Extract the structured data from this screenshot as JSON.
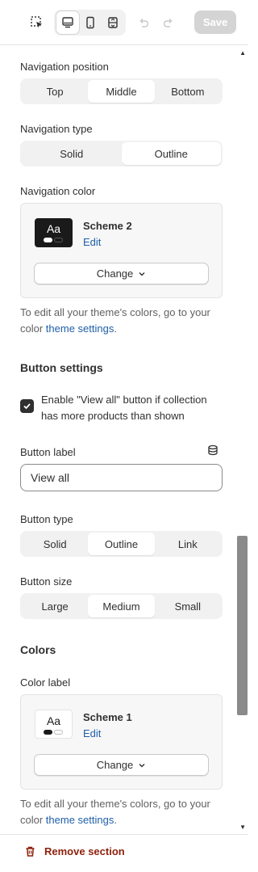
{
  "toolbar": {
    "tools": [
      "inspector-icon",
      "desktop-icon",
      "mobile-icon",
      "fullwidth-icon",
      "undo-icon",
      "redo-icon"
    ],
    "save_label": "Save"
  },
  "navigation_position": {
    "label": "Navigation position",
    "options": [
      "Top",
      "Middle",
      "Bottom"
    ],
    "selected": "Middle"
  },
  "navigation_type": {
    "label": "Navigation type",
    "options": [
      "Solid",
      "Outline"
    ],
    "selected": "Outline"
  },
  "navigation_color": {
    "label": "Navigation color",
    "swatch_text": "Aa",
    "scheme_name": "Scheme 2",
    "edit_label": "Edit",
    "change_label": "Change"
  },
  "help_text_1": {
    "prefix": "To edit all your theme's colors, go to your color ",
    "link": "theme settings",
    "suffix": "."
  },
  "button_settings": {
    "heading": "Button settings",
    "checkbox_label": "Enable \"View all\" button if collection has more products than shown",
    "checkbox_checked": true,
    "button_label_label": "Button label",
    "button_label_value": "View all",
    "button_type": {
      "label": "Button type",
      "options": [
        "Solid",
        "Outline",
        "Link"
      ],
      "selected": "Outline"
    },
    "button_size": {
      "label": "Button size",
      "options": [
        "Large",
        "Medium",
        "Small"
      ],
      "selected": "Medium"
    }
  },
  "colors": {
    "heading": "Colors",
    "color_label": "Color label",
    "swatch_text": "Aa",
    "scheme_name": "Scheme 1",
    "edit_label": "Edit",
    "change_label": "Change"
  },
  "help_text_2": {
    "prefix": "To edit all your theme's colors, go to your color ",
    "link": "theme settings",
    "suffix": "."
  },
  "footer": {
    "remove_label": "Remove section"
  },
  "colors_palette": {
    "link": "#1f5fa8",
    "danger": "#8e1f0b",
    "selected_segment": "#ffffff",
    "segment_track": "#f1f1f1"
  }
}
